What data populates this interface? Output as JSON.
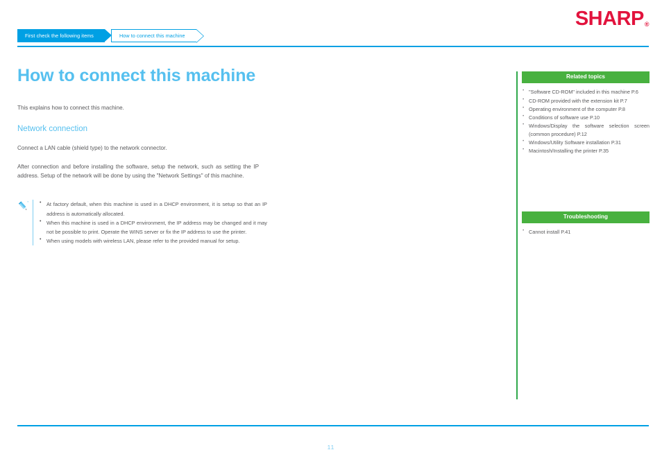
{
  "brand": {
    "logo_text": "SHARP",
    "registered_mark": "®",
    "logo_color": "#e2133d"
  },
  "breadcrumb": {
    "items": [
      {
        "label": "First check the following items",
        "active": true
      },
      {
        "label": "How to connect this machine",
        "active": false
      }
    ]
  },
  "main": {
    "title": "How to connect this machine",
    "intro": "This explains how to connect this machine.",
    "section_heading": "Network connection",
    "paragraph_1": "Connect a LAN cable (shield type) to the network connector.",
    "paragraph_2": "After connection and before installing the software, setup the network, such as setting the IP address. Setup of the network will be done by using the \"Network Settings\" of this machine.",
    "note": {
      "icon": "pencil-icon",
      "items": [
        "At factory default, when this machine is used in a DHCP environment, it is setup so that an IP address is automatically allocated.",
        "When this machine is used in a DHCP environment, the IP address may be changed and it may not be possible to print. Operate the WINS server or fix the IP address to use the printer.",
        "When using models with wireless LAN, please refer to the provided manual for setup."
      ]
    }
  },
  "sidebar": {
    "accent_color": "#48b13f",
    "related": {
      "heading": "Related topics",
      "items": [
        "\"Software CD-ROM\" included in this machine P.6",
        "CD-ROM provided with the extension kit P.7",
        "Operating environment of the computer P.8",
        "Conditions of software use P.10",
        "Windows/Display the software selection screen (common procedure) P.12",
        "Windows/Utility Software installation P.31",
        "Macintosh/Installing the printer P.35"
      ]
    },
    "troubleshooting": {
      "heading": "Troubleshooting",
      "items": [
        "Cannot install P.41"
      ]
    }
  },
  "footer": {
    "page_number": "11",
    "accent_color": "#00a0e4"
  }
}
